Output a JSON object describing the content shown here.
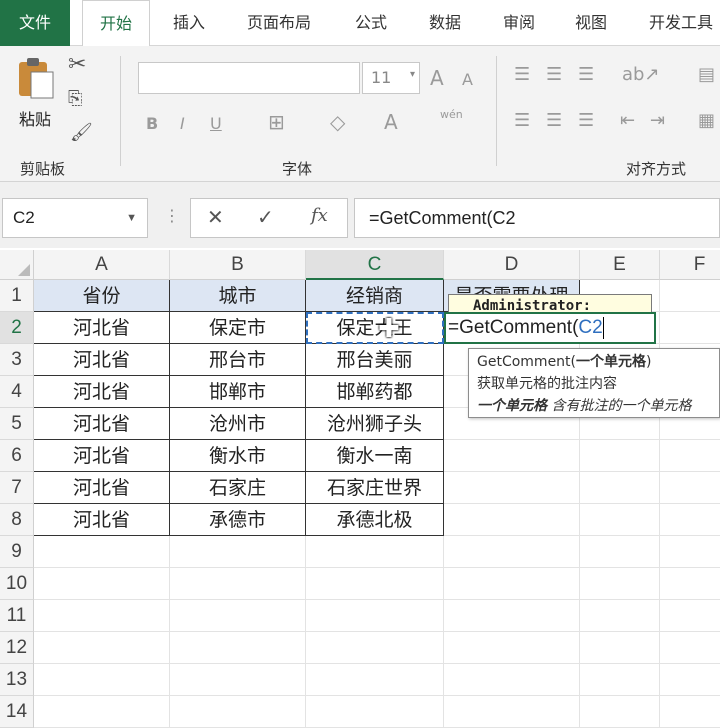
{
  "tabs": [
    "文件",
    "开始",
    "插入",
    "页面布局",
    "公式",
    "数据",
    "审阅",
    "视图",
    "开发工具"
  ],
  "ribbon": {
    "clipboard": {
      "paste_label": "粘贴",
      "group_label": "剪贴板"
    },
    "font": {
      "size": "11",
      "group_label": "字体",
      "bold": "B",
      "italic": "I",
      "underline": "U",
      "grow": "A",
      "shrink": "A",
      "phonetic": "wén"
    },
    "alignment": {
      "group_label": "对齐方式"
    }
  },
  "formula_bar": {
    "name_box": "C2",
    "formula": "=GetComment(C2",
    "cancel": "✕",
    "enter": "✓",
    "fx": "fx"
  },
  "columns": [
    "A",
    "B",
    "C",
    "D",
    "E",
    "F"
  ],
  "rows": [
    "1",
    "2",
    "3",
    "4",
    "5",
    "6",
    "7",
    "8",
    "9",
    "10",
    "11",
    "12",
    "13",
    "14"
  ],
  "table": {
    "header": [
      "省份",
      "城市",
      "经销商",
      "是否需要处理"
    ],
    "rows": [
      [
        "河北省",
        "保定市",
        "保定大王"
      ],
      [
        "河北省",
        "邢台市",
        "邢台美丽"
      ],
      [
        "河北省",
        "邯郸市",
        "邯郸药都"
      ],
      [
        "河北省",
        "沧州市",
        "沧州狮子头"
      ],
      [
        "河北省",
        "衡水市",
        "衡水一南"
      ],
      [
        "河北省",
        "石家庄",
        "石家庄世界"
      ],
      [
        "河北省",
        "承德市",
        "承德北极"
      ]
    ]
  },
  "comment": {
    "author": "Administrator:"
  },
  "cell_editor": {
    "prefix": "=GetComment(",
    "ref": "C2"
  },
  "tooltip": {
    "signature_name": "GetComment(",
    "signature_arg": "一个单元格",
    "signature_close": ")",
    "description": "获取单元格的批注内容",
    "arg_name": "一个单元格",
    "arg_desc": "含有批注的一个单元格"
  },
  "colors": {
    "excel_green": "#217346",
    "header_fill": "#dde6f3",
    "comment_marker": "#d9261c",
    "ref_blue": "#2f6fbf"
  }
}
